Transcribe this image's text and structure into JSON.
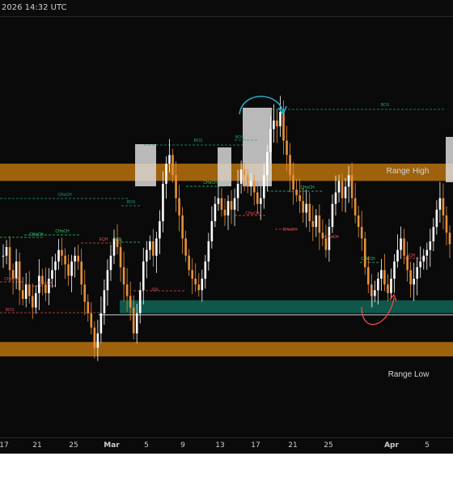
{
  "header": {
    "timestamp": "2026 14:32 UTC"
  },
  "colors": {
    "background": "#0a0a0a",
    "range_band": "#b8720e",
    "demand_zone": "#0f5f52",
    "candle_up": "#ffffff",
    "candle_down": "#e8913a",
    "bos_teal": "#1e9c8c",
    "bos_red": "#d24a4a",
    "choch_green": "#33cc77",
    "choch_red": "#e05050",
    "highlight_box": "#d8d8d8",
    "arrow_blue": "#29a9c9",
    "arrow_red": "#e04a4a"
  },
  "range_labels": {
    "high": "Range High",
    "low": "Range Low"
  },
  "x_axis": {
    "ticks": [
      "17",
      "21",
      "25",
      "Mar",
      "5",
      "9",
      "13",
      "17",
      "21",
      "25",
      "Apr",
      "5"
    ],
    "bold": [
      "Mar",
      "Apr"
    ]
  },
  "chart_data": {
    "type": "candlestick",
    "title": "",
    "xlabel": "",
    "ylabel": "",
    "grid": false,
    "close": [
      0.6,
      0.63,
      0.55,
      0.52,
      0.58,
      0.48,
      0.45,
      0.5,
      0.46,
      0.42,
      0.47,
      0.53,
      0.5,
      0.47,
      0.52,
      0.55,
      0.58,
      0.62,
      0.6,
      0.57,
      0.53,
      0.58,
      0.6,
      0.58,
      0.5,
      0.44,
      0.4,
      0.35,
      0.28,
      0.33,
      0.4,
      0.48,
      0.55,
      0.6,
      0.66,
      0.63,
      0.56,
      0.5,
      0.46,
      0.42,
      0.33,
      0.4,
      0.48,
      0.58,
      0.62,
      0.65,
      0.6,
      0.66,
      0.72,
      0.85,
      0.92,
      0.95,
      0.88,
      0.8,
      0.74,
      0.66,
      0.6,
      0.55,
      0.52,
      0.5,
      0.48,
      0.52,
      0.58,
      0.65,
      0.72,
      0.78,
      0.8,
      0.76,
      0.74,
      0.79,
      0.76,
      0.8,
      0.85,
      0.9,
      0.88,
      0.84,
      0.86,
      0.82,
      0.78,
      0.8,
      0.88,
      0.96,
      1.04,
      1.07,
      1.05,
      1.1,
      1.0,
      0.95,
      0.88,
      0.83,
      0.81,
      0.79,
      0.75,
      0.78,
      0.72,
      0.7,
      0.74,
      0.68,
      0.66,
      0.62,
      0.7,
      0.78,
      0.82,
      0.86,
      0.8,
      0.84,
      0.88,
      0.8,
      0.74,
      0.7,
      0.66,
      0.56,
      0.5,
      0.46,
      0.48,
      0.52,
      0.55,
      0.5,
      0.47,
      0.52,
      0.58,
      0.62,
      0.66,
      0.6,
      0.55,
      0.5,
      0.52,
      0.56,
      0.58,
      0.6,
      0.62,
      0.65,
      0.7,
      0.76,
      0.8,
      0.74,
      0.68,
      0.64
    ],
    "value_range": [
      0.25,
      1.12
    ],
    "range_high_band": [
      0.86,
      0.92
    ],
    "range_low_band": [
      0.25,
      0.3
    ],
    "demand_zone": [
      0.4,
      0.445
    ],
    "annotations": [
      "BOS",
      "BOS",
      "BOS",
      "BOS",
      "CHoCH",
      "CHoCH",
      "CHoCH",
      "CHoCH",
      "CHoCH",
      "CHoCH",
      "CHoCH",
      "CHoCH",
      "CHoCH",
      "EQH",
      "EQH",
      "EQL",
      "SSL"
    ]
  }
}
